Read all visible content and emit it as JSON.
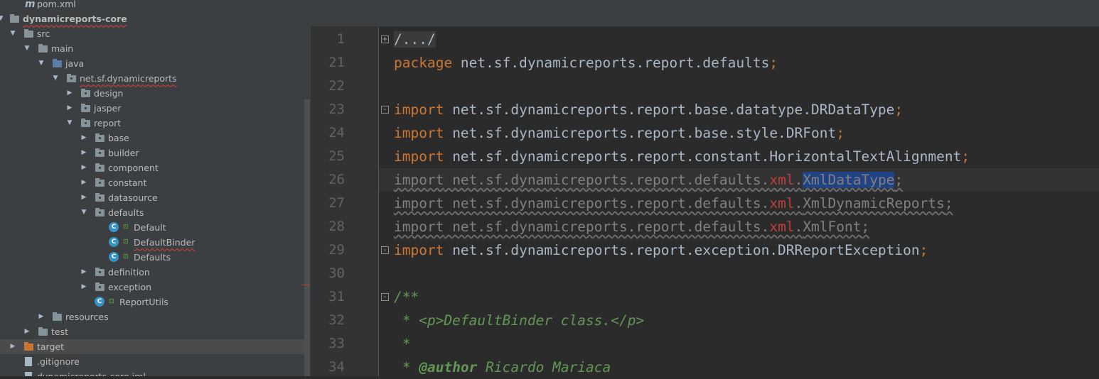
{
  "tree": {
    "items": [
      {
        "label": "pom.xml",
        "icon": "maven-icon"
      },
      {
        "label": "dynamicreports-core",
        "icon": "module-folder-icon"
      },
      {
        "label": "src",
        "icon": "folder-icon"
      },
      {
        "label": "main",
        "icon": "folder-icon"
      },
      {
        "label": "java",
        "icon": "source-folder-icon"
      },
      {
        "label": "net.sf.dynamicreports",
        "icon": "package-icon"
      },
      {
        "label": "design",
        "icon": "package-icon"
      },
      {
        "label": "jasper",
        "icon": "package-icon"
      },
      {
        "label": "report",
        "icon": "package-icon"
      },
      {
        "label": "base",
        "icon": "package-icon"
      },
      {
        "label": "builder",
        "icon": "package-icon"
      },
      {
        "label": "component",
        "icon": "package-icon"
      },
      {
        "label": "constant",
        "icon": "package-icon"
      },
      {
        "label": "datasource",
        "icon": "package-icon"
      },
      {
        "label": "defaults",
        "icon": "package-icon"
      },
      {
        "label": "Default",
        "icon": "class-icon"
      },
      {
        "label": "DefaultBinder",
        "icon": "class-icon"
      },
      {
        "label": "Defaults",
        "icon": "class-icon"
      },
      {
        "label": "definition",
        "icon": "package-icon"
      },
      {
        "label": "exception",
        "icon": "package-icon"
      },
      {
        "label": "ReportUtils",
        "icon": "class-icon"
      },
      {
        "label": "resources",
        "icon": "folder-icon"
      },
      {
        "label": "test",
        "icon": "folder-icon"
      },
      {
        "label": "target",
        "icon": "excluded-folder-icon"
      },
      {
        "label": ".gitignore",
        "icon": "file-icon"
      },
      {
        "label": "dynamicreports-core.iml",
        "icon": "file-icon"
      }
    ]
  },
  "editor": {
    "line_numbers": [
      "1",
      "21",
      "22",
      "23",
      "24",
      "25",
      "26",
      "27",
      "28",
      "29",
      "30",
      "31",
      "32",
      "33",
      "34"
    ],
    "code": {
      "l1": "/.../",
      "l21_kw": "package",
      "l21_path": " net.sf.dynamicreports.report.defaults",
      "semi": ";",
      "import_kw": "import",
      "l23_path": " net.sf.dynamicreports.report.base.datatype.DRDataType",
      "l24_path": " net.sf.dynamicreports.report.base.style.DRFont",
      "l25_path": " net.sf.dynamicreports.report.constant.HorizontalTextAlignment",
      "defaults_prefix": " net.sf.dynamicreports.report.defaults.",
      "xml": "xml",
      "dot": ".",
      "l26_class": "XmlDataType",
      "l27_class": "XmlDynamicReports",
      "l28_class": "XmlFont",
      "l29_path": " net.sf.dynamicreports.report.exception.DRReportException",
      "l31": "/**",
      "l32": " * <p>DefaultBinder class.</p>",
      "l33": " *",
      "l34_star": " * ",
      "l34_tag": "@author",
      "l34_name": " Ricardo Mariaca"
    },
    "fold_markers": {
      "plus": "+",
      "minus": "-"
    }
  },
  "colors": {
    "tree_bg": "#3c3f41",
    "editor_bg": "#2b2b2b",
    "keyword": "#cc7832",
    "doc": "#629755",
    "selection": "#214283",
    "error": "#bc3f3c"
  }
}
